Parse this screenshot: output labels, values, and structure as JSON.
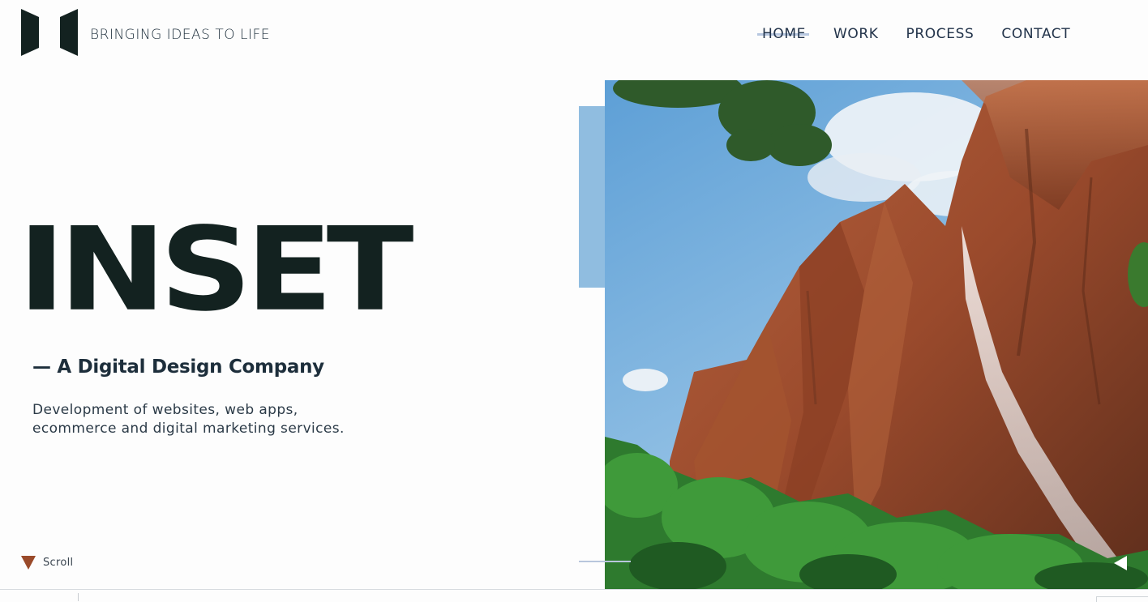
{
  "header": {
    "tagline": "BRINGING IDEAS TO LIFE",
    "logo_icon": "inset-logo-mark"
  },
  "nav": {
    "items": [
      {
        "label": "HOME",
        "active": true
      },
      {
        "label": "WORK",
        "active": false
      },
      {
        "label": "PROCESS",
        "active": false
      },
      {
        "label": "CONTACT",
        "active": false
      }
    ]
  },
  "hero": {
    "title": "INSET",
    "subtitle": "— A Digital Design Company",
    "description_line1": "Development of websites, web apps,",
    "description_line2": "ecommerce and digital marketing services.",
    "scroll_label": "Scroll"
  },
  "slider": {
    "prev_icon": "triangle-left-icon"
  },
  "colors": {
    "brand_dark": "#132220",
    "accent_blue": "#90bde0",
    "scroll_triangle": "#9a4a2a",
    "nav_highlight": "#b7c7e0"
  }
}
